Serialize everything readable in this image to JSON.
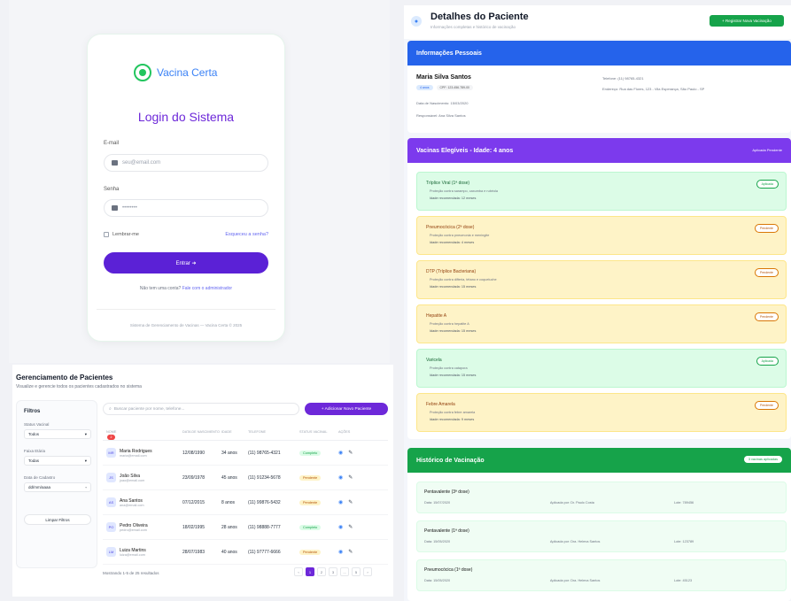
{
  "login": {
    "brand": "Vacina Certa",
    "title": "Login do Sistema",
    "email_label": "E-mail",
    "email_placeholder": "seu@email.com",
    "password_label": "Senha",
    "password_placeholder": "••••••••",
    "remember": "Lembrar-me",
    "forgot": "Esqueceu a senha?",
    "submit": "Entrar ➜",
    "no_account": "Não tem uma conta?",
    "no_account_link": "Fale com o administrador",
    "footer": "Sistema de Gerenciamento de Vacinas — Vacina Certa © 2025"
  },
  "patients": {
    "title": "Gerenciamento de Pacientes",
    "subtitle": "Visualize e gerencie todos os pacientes cadastrados no sistema",
    "filters": {
      "title": "Filtros",
      "status_label": "Status Vacinal",
      "status_value": "Todos",
      "age_label": "Faixa Etária",
      "age_value": "Todas",
      "date_label": "Data de Cadastro",
      "date_value": "dd/mm/aaaa",
      "clear": "Limpar Filtros"
    },
    "search_placeholder": "Buscar paciente por nome, telefone...",
    "add_button": "+ Adicionar Novo Paciente",
    "new_badge": "2",
    "columns": [
      "NOME",
      "DATA DE NASCIMENTO",
      "IDADE",
      "TELEFONE",
      "STATUS VACINAL",
      "AÇÕES"
    ],
    "rows": [
      {
        "initials": "MR",
        "name": "Maria Rodrigues",
        "email": "maria@email.com",
        "dob": "12/08/1990",
        "age": "34 anos",
        "phone": "(11) 98765-4321",
        "status": "Completo",
        "status_color": "green"
      },
      {
        "initials": "JS",
        "name": "João Silva",
        "email": "joao@email.com",
        "dob": "23/09/1978",
        "age": "45 anos",
        "phone": "(11) 91234-5678",
        "status": "Pendente",
        "status_color": "yellow"
      },
      {
        "initials": "AS",
        "name": "Ana Santos",
        "email": "ana@email.com",
        "dob": "07/12/2015",
        "age": "8 anos",
        "phone": "(11) 99876-5432",
        "status": "Pendente",
        "status_color": "yellow"
      },
      {
        "initials": "PO",
        "name": "Pedro Oliveira",
        "email": "pedro@email.com",
        "dob": "18/02/1995",
        "age": "28 anos",
        "phone": "(11) 98888-7777",
        "status": "Completo",
        "status_color": "green"
      },
      {
        "initials": "LM",
        "name": "Luiza Martins",
        "email": "luiza@email.com",
        "dob": "28/07/1983",
        "age": "40 anos",
        "phone": "(11) 97777-6666",
        "status": "Pendente",
        "status_color": "yellow"
      }
    ],
    "pager_text": "Mostrando 1-5 de 25 resultados",
    "pages": [
      "‹",
      "1",
      "2",
      "3",
      "...",
      "5",
      "›"
    ]
  },
  "detail": {
    "title": "Detalhes do Paciente",
    "subtitle": "Informações completas e histórico de vacinação",
    "register_button": "+ Registrar Nova Vacinação",
    "personal_header": "Informações Pessoais",
    "patient_name": "Maria Silva Santos",
    "tag1": "4 anos",
    "tag2": "CPF: 123.456.789-00",
    "birth": "Data de Nascimento: 15/03/2020",
    "guardian": "Responsável: Ana Silva Santos",
    "phone": "Telefone: (11) 98765-4321",
    "address": "Endereço: Rua das Flores, 123 - Vila Esperança, São Paulo - SP",
    "eligible_header": "Vacinas Elegíveis - Idade: 4 anos",
    "eligible_legend": "Aplicada   Pendente",
    "vaccines": [
      {
        "name": "Tríplice Viral (1ª dose)",
        "desc": "Proteção contra sarampo, caxumba e rubéola",
        "age": "Idade recomendada: 12 meses",
        "badge": "Aplicada",
        "color": "green"
      },
      {
        "name": "Pneumocócica (2ª dose)",
        "desc": "Proteção contra pneumonia e meningite",
        "age": "Idade recomendada: 4 meses",
        "badge": "Pendente",
        "color": "yellow"
      },
      {
        "name": "DTP (Tríplice Bacteriana)",
        "desc": "Proteção contra difteria, tétano e coqueluche",
        "age": "Idade recomendada: 15 meses",
        "badge": "Pendente",
        "color": "yellow"
      },
      {
        "name": "Hepatite A",
        "desc": "Proteção contra hepatite A",
        "age": "Idade recomendada: 15 meses",
        "badge": "Pendente",
        "color": "yellow"
      },
      {
        "name": "Varicela",
        "desc": "Proteção contra catapora",
        "age": "Idade recomendada: 15 meses",
        "badge": "Aplicada",
        "color": "green"
      },
      {
        "name": "Febre Amarela",
        "desc": "Proteção contra febre amarela",
        "age": "Idade recomendada: 9 meses",
        "badge": "Pendente",
        "color": "yellow"
      }
    ],
    "history_header": "Histórico de Vacinação",
    "history_badge": "3 vacinas aplicadas",
    "history": [
      {
        "name": "Pentavalente (3ª dose)",
        "date": "Data: 15/07/2020",
        "applied": "Aplicada por: Dr. Paulo Costa",
        "lot": "Lote: 789456"
      },
      {
        "name": "Pentavalente (1ª dose)",
        "date": "Data: 15/05/2020",
        "applied": "Aplicada por: Dra. Helena Santos",
        "lot": "Lote: 123789"
      },
      {
        "name": "Pneumocócica (1ª dose)",
        "date": "Data: 15/05/2020",
        "applied": "Aplicada por: Dra. Helena Santos",
        "lot": "Lote: 45123"
      }
    ]
  },
  "colors": {
    "purple": "#6d28d9",
    "blue_header": "#2563eb",
    "purple_header": "#7c3aed",
    "green_header": "#16a34a"
  }
}
